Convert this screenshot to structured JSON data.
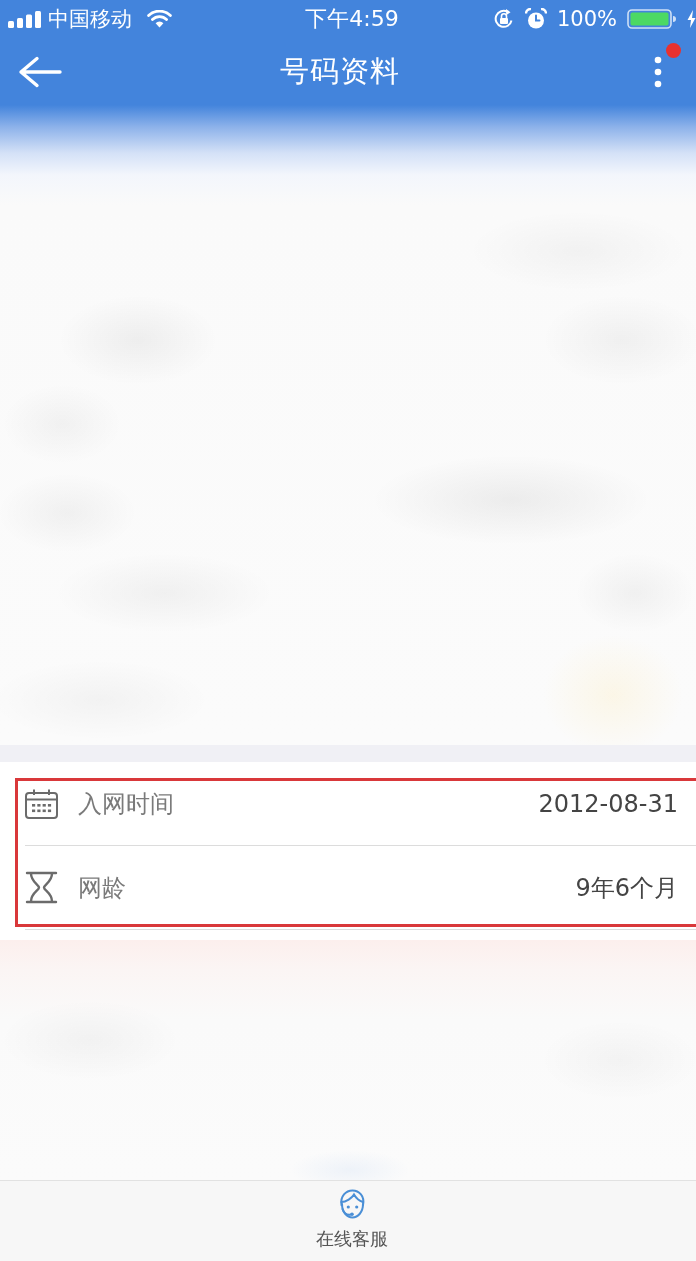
{
  "status_bar": {
    "carrier": "中国移动",
    "time": "下午4:59",
    "battery": "100%"
  },
  "nav_bar": {
    "title": "号码资料",
    "notification": true
  },
  "info_card": {
    "highlighted": true,
    "rows": [
      {
        "kind": "calendar",
        "label": "入网时间",
        "value": "2012-08-31"
      },
      {
        "kind": "hourglass",
        "label": "网龄",
        "value": "9年6个月"
      }
    ]
  },
  "bottom_bar": {
    "items": [
      {
        "label": "在线客服"
      }
    ]
  }
}
